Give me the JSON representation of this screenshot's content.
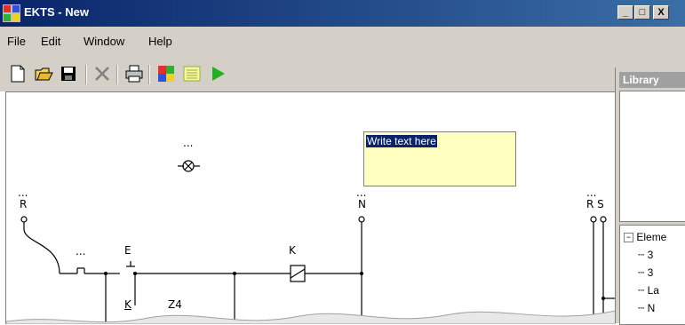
{
  "window": {
    "title": "EKTS - New",
    "minimize": "_",
    "maximize": "□",
    "close": "X"
  },
  "menu": {
    "items": [
      "File",
      "Edit",
      "Window",
      "Help"
    ]
  },
  "toolbar": {
    "icons": [
      "new-icon",
      "open-icon",
      "save-icon",
      "delete-icon",
      "print-icon",
      "palette-icon",
      "grid-icon",
      "run-icon"
    ]
  },
  "library": {
    "header": "Library"
  },
  "tree": {
    "root": "Eleme",
    "children": [
      "3",
      "3",
      "La",
      "N"
    ]
  },
  "canvas": {
    "textbox": "Write text here",
    "lamp_label": "...",
    "labels": {
      "r_dots": "...",
      "r": "R",
      "n_dots": "...",
      "n": "N",
      "rs_dots": "...",
      "rs": "R S",
      "switch_dots": "...",
      "e": "E",
      "k_top": "K",
      "k_bottom": "K",
      "z4": "Z4"
    }
  }
}
